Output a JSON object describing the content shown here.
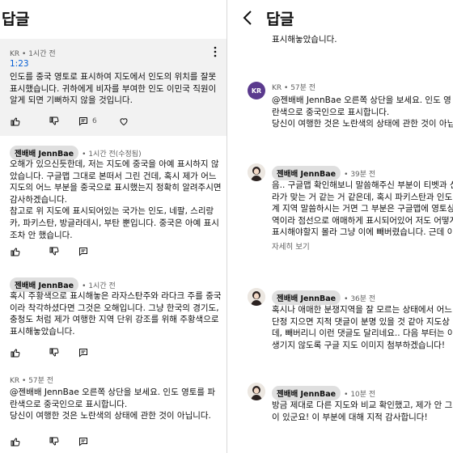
{
  "left": {
    "header_title": "답글",
    "comments": [
      {
        "author": "KR",
        "time": "1시간 전",
        "timestamp_link": "1:23",
        "lines": [
          "인도를 중국 영토로 표시하여 지도에서 인도의 위치를 잘못",
          "표시했습니다. 귀하에게 비자를 부여한 인도 이민국 직원이",
          "알게 되면 기뻐하지 않을 것입니다."
        ],
        "reply_count": "6"
      },
      {
        "author": "젠배배 JennBae",
        "time": "1시간 전(수정됨)",
        "lines": [
          "오해가 있으신듯한데, 저는 지도에 중국을 아예 표시하지 않",
          "았습니다. 구글맵 그대로 본떠서 그린 건데, 혹시 제가 어느",
          "지도의 어느 부분을 중국으로 표시했는지 정확히 알려주시면",
          "감사하겠습니다.",
          "참고로 위 지도에 표시되어있는 국가는 인도, 네팔, 스리랑",
          "카, 파키스탄, 방글라데시, 부탄 뿐입니다. 중국은 아예 표시",
          "조차 안 했습니다."
        ]
      },
      {
        "author": "젠배배 JennBae",
        "time": "1시간 전",
        "lines": [
          "혹시 주황색으로 표시해놓은 라자스탄주와 라다크 주를 중국",
          "이라 착각하셨다면 그것은 오해입니다. 그냥 한국의 경기도,",
          "충청도 처럼 제가 여행한 지역 단위 강조를 위해 주황색으로",
          "표시해놓았습니다."
        ]
      },
      {
        "author": "KR",
        "time": "57분 전",
        "lines": [
          "@젠배배 JennBae  오른쪽 상단을 보세요. 인도 영토를 파",
          "란색으로 중국인으로 표시합니다.",
          "당신이 여행한 것은 노란색의 상태에 관한 것이 아닙니다."
        ]
      }
    ]
  },
  "right": {
    "header_title": "답글",
    "top_fragment": "표시해놓았습니다.",
    "comments": [
      {
        "author": "KR",
        "avatar_text": "KR",
        "time": "57분 전",
        "lines": [
          "@젠배배 JennBae  오른쪽 상단을 보세요. 인도 영",
          "란색으로 중국인으로 표시합니다.",
          "당신이 여행한 것은 노란색의 상태에 관한 것이 아닙"
        ]
      },
      {
        "author": "젠배배 JennBae",
        "time": "39분 전",
        "lines": [
          "음.. 구글맵 확인해보니 말씀해주신 부분이 티벳과 신",
          "라가 맞는 거 같는 거 같은데, 혹시 파키스탄과 인도 ",
          "계 지역 말씀하시는 거면 그 부분은 구글맵에 영토상",
          "역이라 점선으로 애매하게 표시되어있어 저도 어떻게",
          "표시해야할지 몰라 그냥 이에 빼버렸습니다. 근데 이"
        ],
        "more": "자세히 보기"
      },
      {
        "author": "젠배배 JennBae",
        "time": "36분 전",
        "lines": [
          "혹시나 애매한 분쟁지역을 잘 모르는 상태에서 어느 ",
          "단정 지으면 지적 댓글이 분명 있을 것 같아 지도상 ",
          "데, 빼버리니 이런 댓글도 달리네요.. 다음 부터는 이",
          "생기지 않도록 구글 지도 이미지 첨부하겠습니다!"
        ]
      },
      {
        "author": "젠배배 JennBae",
        "time": "10분 전",
        "lines": [
          "방금 제대로 다른 지도와 비교 확인했고, 제가 안 그린",
          "이 있군요! 이 부분에 대해 지적 감사합니다!"
        ]
      }
    ]
  },
  "colors": {
    "link": "#065fd4",
    "chip_bg": "#dfdfdf",
    "highlight_bg": "#f2f2f2",
    "kr_avatar": "#5b3a8e"
  },
  "icons": [
    "chevron-left-icon",
    "thumbs-up-icon",
    "thumbs-down-icon",
    "reply-icon",
    "more-vert-icon"
  ]
}
